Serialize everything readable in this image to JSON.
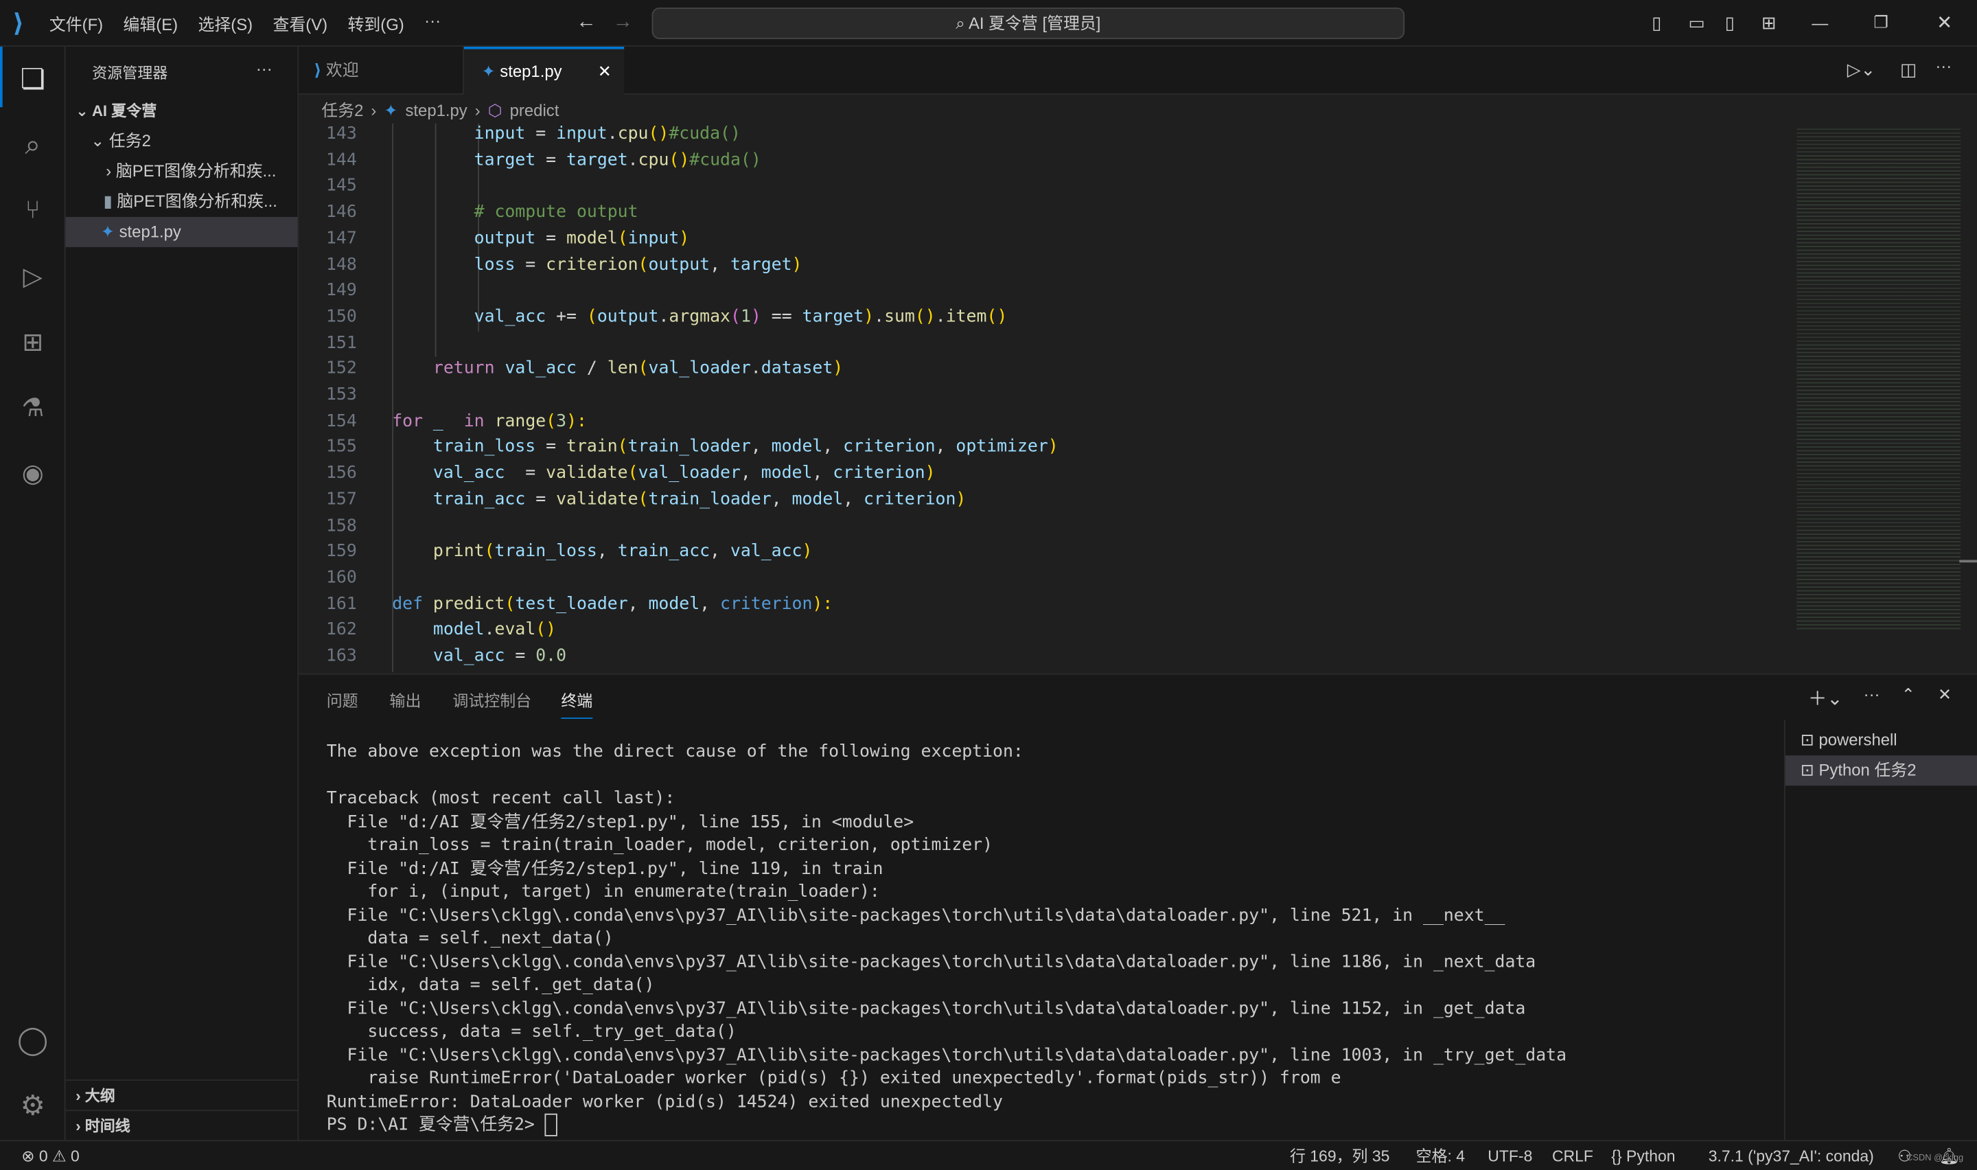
{
  "titlebar": {
    "menus": [
      "文件(F)",
      "编辑(E)",
      "选择(S)",
      "查看(V)",
      "转到(G)",
      "···"
    ],
    "search": "AI 夏令营 [管理员]"
  },
  "sidebar": {
    "title": "资源管理器",
    "more": "···",
    "root": "AI 夏令营",
    "folder": "任务2",
    "items": [
      "脑PET图像分析和疾...",
      "脑PET图像分析和疾...",
      "step1.py"
    ],
    "outline": "大纲",
    "timeline": "时间线"
  },
  "tabs": [
    {
      "label": "欢迎"
    },
    {
      "label": "step1.py",
      "active": true
    }
  ],
  "breadcrumb": [
    "任务2",
    "step1.py",
    "predict"
  ],
  "code": [
    {
      "n": "143",
      "t": [
        [
          "        ",
          ""
        ],
        [
          "input",
          "v"
        ],
        [
          " = ",
          "t"
        ],
        [
          "input",
          "v"
        ],
        [
          ".",
          "t"
        ],
        [
          "cpu",
          "f"
        ],
        [
          "()",
          "p"
        ],
        [
          "#cuda()",
          "c"
        ]
      ]
    },
    {
      "n": "144",
      "t": [
        [
          "        ",
          ""
        ],
        [
          "target",
          "v"
        ],
        [
          " = ",
          "t"
        ],
        [
          "target",
          "v"
        ],
        [
          ".",
          "t"
        ],
        [
          "cpu",
          "f"
        ],
        [
          "()",
          "p"
        ],
        [
          "#cuda()",
          "c"
        ]
      ]
    },
    {
      "n": "145",
      "t": []
    },
    {
      "n": "146",
      "t": [
        [
          "        ",
          ""
        ],
        [
          "# compute output",
          "c"
        ]
      ]
    },
    {
      "n": "147",
      "t": [
        [
          "        ",
          ""
        ],
        [
          "output",
          "v"
        ],
        [
          " = ",
          "t"
        ],
        [
          "model",
          "f"
        ],
        [
          "(",
          "p"
        ],
        [
          "input",
          "v"
        ],
        [
          ")",
          "p"
        ]
      ]
    },
    {
      "n": "148",
      "t": [
        [
          "        ",
          ""
        ],
        [
          "loss",
          "v"
        ],
        [
          " = ",
          "t"
        ],
        [
          "criterion",
          "f"
        ],
        [
          "(",
          "p"
        ],
        [
          "output",
          "v"
        ],
        [
          ", ",
          "t"
        ],
        [
          "target",
          "v"
        ],
        [
          ")",
          "p"
        ]
      ]
    },
    {
      "n": "149",
      "t": []
    },
    {
      "n": "150",
      "t": [
        [
          "        ",
          ""
        ],
        [
          "val_acc",
          "v"
        ],
        [
          " += ",
          "t"
        ],
        [
          "(",
          "p"
        ],
        [
          "output",
          "v"
        ],
        [
          ".",
          "t"
        ],
        [
          "argmax",
          "f"
        ],
        [
          "(",
          "p2"
        ],
        [
          "1",
          "n"
        ],
        [
          ")",
          "p2"
        ],
        [
          " == ",
          "t"
        ],
        [
          "target",
          "v"
        ],
        [
          ")",
          "p"
        ],
        [
          ".",
          "t"
        ],
        [
          "sum",
          "f"
        ],
        [
          "()",
          "p"
        ],
        [
          ".",
          "t"
        ],
        [
          "item",
          "f"
        ],
        [
          "()",
          "p"
        ]
      ]
    },
    {
      "n": "151",
      "t": []
    },
    {
      "n": "152",
      "t": [
        [
          "    ",
          ""
        ],
        [
          "return ",
          "kw"
        ],
        [
          "val_acc",
          "v"
        ],
        [
          " / ",
          "t"
        ],
        [
          "len",
          "f"
        ],
        [
          "(",
          "p"
        ],
        [
          "val_loader",
          "v"
        ],
        [
          ".",
          "t"
        ],
        [
          "dataset",
          "v"
        ],
        [
          ")",
          "p"
        ]
      ]
    },
    {
      "n": "153",
      "t": []
    },
    {
      "n": "154",
      "t": [
        [
          "for ",
          "kw"
        ],
        [
          "_",
          "v"
        ],
        [
          "  in ",
          "kw"
        ],
        [
          "range",
          "f"
        ],
        [
          "(",
          "p"
        ],
        [
          "3",
          "n"
        ],
        [
          "):",
          "p"
        ]
      ]
    },
    {
      "n": "155",
      "t": [
        [
          "    ",
          ""
        ],
        [
          "train_loss",
          "v"
        ],
        [
          " = ",
          "t"
        ],
        [
          "train",
          "f"
        ],
        [
          "(",
          "p"
        ],
        [
          "train_loader",
          "v"
        ],
        [
          ", ",
          "t"
        ],
        [
          "model",
          "v"
        ],
        [
          ", ",
          "t"
        ],
        [
          "criterion",
          "v"
        ],
        [
          ", ",
          "t"
        ],
        [
          "optimizer",
          "v"
        ],
        [
          ")",
          "p"
        ]
      ]
    },
    {
      "n": "156",
      "t": [
        [
          "    ",
          ""
        ],
        [
          "val_acc",
          "v"
        ],
        [
          "  = ",
          "t"
        ],
        [
          "validate",
          "f"
        ],
        [
          "(",
          "p"
        ],
        [
          "val_loader",
          "v"
        ],
        [
          ", ",
          "t"
        ],
        [
          "model",
          "v"
        ],
        [
          ", ",
          "t"
        ],
        [
          "criterion",
          "v"
        ],
        [
          ")",
          "p"
        ]
      ]
    },
    {
      "n": "157",
      "t": [
        [
          "    ",
          ""
        ],
        [
          "train_acc",
          "v"
        ],
        [
          " = ",
          "t"
        ],
        [
          "validate",
          "f"
        ],
        [
          "(",
          "p"
        ],
        [
          "train_loader",
          "v"
        ],
        [
          ", ",
          "t"
        ],
        [
          "model",
          "v"
        ],
        [
          ", ",
          "t"
        ],
        [
          "criterion",
          "v"
        ],
        [
          ")",
          "p"
        ]
      ]
    },
    {
      "n": "158",
      "t": []
    },
    {
      "n": "159",
      "t": [
        [
          "    ",
          ""
        ],
        [
          "print",
          "f"
        ],
        [
          "(",
          "p"
        ],
        [
          "train_loss",
          "v"
        ],
        [
          ", ",
          "t"
        ],
        [
          "train_acc",
          "v"
        ],
        [
          ", ",
          "t"
        ],
        [
          "val_acc",
          "v"
        ],
        [
          ")",
          "p"
        ]
      ]
    },
    {
      "n": "160",
      "t": []
    },
    {
      "n": "161",
      "t": [
        [
          "def ",
          "k"
        ],
        [
          "predict",
          "f"
        ],
        [
          "(",
          "p"
        ],
        [
          "test_loader",
          "v"
        ],
        [
          ", ",
          "t"
        ],
        [
          "model",
          "v"
        ],
        [
          ", ",
          "t"
        ],
        [
          "criterion",
          "k"
        ],
        [
          "):",
          "p"
        ]
      ]
    },
    {
      "n": "162",
      "t": [
        [
          "    ",
          ""
        ],
        [
          "model",
          "v"
        ],
        [
          ".",
          "t"
        ],
        [
          "eval",
          "f"
        ],
        [
          "()",
          "p"
        ]
      ]
    },
    {
      "n": "163",
      "t": [
        [
          "    ",
          ""
        ],
        [
          "val_acc",
          "v"
        ],
        [
          " = ",
          "t"
        ],
        [
          "0.0",
          "n"
        ]
      ]
    }
  ],
  "panel": {
    "tabs": [
      "问题",
      "输出",
      "调试控制台",
      "终端"
    ],
    "active": "终端",
    "terminals": [
      "powershell",
      "Python 任务2"
    ]
  },
  "terminal": [
    "The above exception was the direct cause of the following exception:",
    "",
    "Traceback (most recent call last):",
    "  File \"d:/AI 夏令营/任务2/step1.py\", line 155, in <module>",
    "    train_loss = train(train_loader, model, criterion, optimizer)",
    "  File \"d:/AI 夏令营/任务2/step1.py\", line 119, in train",
    "    for i, (input, target) in enumerate(train_loader):",
    "  File \"C:\\Users\\cklgg\\.conda\\envs\\py37_AI\\lib\\site-packages\\torch\\utils\\data\\dataloader.py\", line 521, in __next__",
    "    data = self._next_data()",
    "  File \"C:\\Users\\cklgg\\.conda\\envs\\py37_AI\\lib\\site-packages\\torch\\utils\\data\\dataloader.py\", line 1186, in _next_data",
    "    idx, data = self._get_data()",
    "  File \"C:\\Users\\cklgg\\.conda\\envs\\py37_AI\\lib\\site-packages\\torch\\utils\\data\\dataloader.py\", line 1152, in _get_data",
    "    success, data = self._try_get_data()",
    "  File \"C:\\Users\\cklgg\\.conda\\envs\\py37_AI\\lib\\site-packages\\torch\\utils\\data\\dataloader.py\", line 1003, in _try_get_data",
    "    raise RuntimeError('DataLoader worker (pid(s) {}) exited unexpectedly'.format(pids_str)) from e",
    "RuntimeError: DataLoader worker (pid(s) 14524) exited unexpectedly",
    "PS D:\\AI 夏令营\\任务2> "
  ],
  "status": {
    "errors": "0",
    "warnings": "0",
    "position": "行 169，列 35",
    "spaces": "空格: 4",
    "encoding": "UTF-8",
    "eol": "CRLF",
    "language": "Python",
    "interpreter": "3.7.1 ('py37_AI': conda)",
    "watermark": "CSDN @cklgg"
  },
  "colors": {
    "accent": "#0078d4",
    "background": "#1f1f1f"
  }
}
